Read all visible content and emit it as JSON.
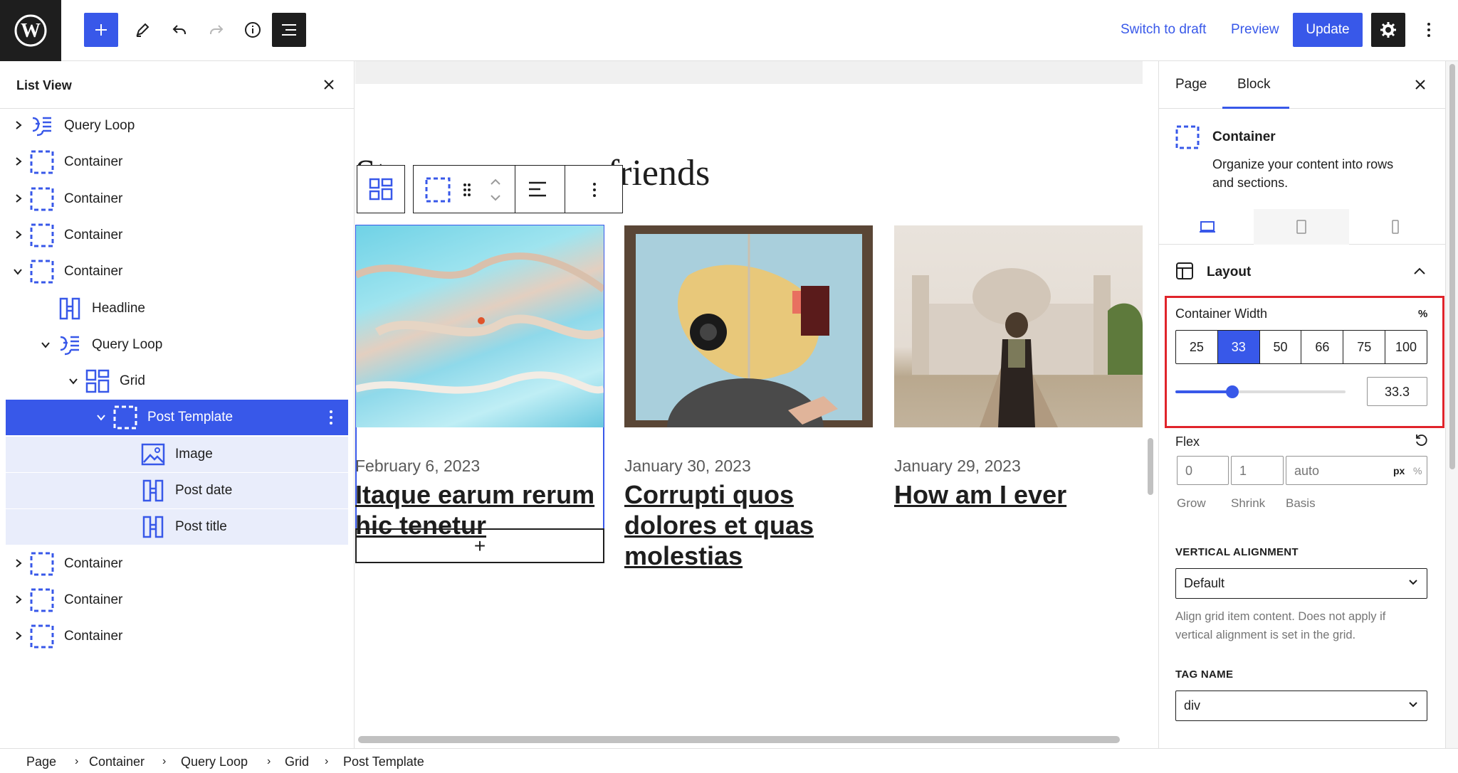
{
  "toolbar": {
    "switch_to_draft": "Switch to draft",
    "preview": "Preview",
    "update": "Update"
  },
  "list_view": {
    "title": "List View",
    "items": [
      {
        "label": "Query Loop",
        "icon": "query-loop-icon"
      },
      {
        "label": "Container",
        "icon": "container-icon"
      },
      {
        "label": "Container",
        "icon": "container-icon"
      },
      {
        "label": "Container",
        "icon": "container-icon"
      },
      {
        "label": "Container",
        "icon": "container-icon"
      },
      {
        "label": "Headline",
        "icon": "headline-icon"
      },
      {
        "label": "Query Loop",
        "icon": "query-loop-icon"
      },
      {
        "label": "Grid",
        "icon": "grid-icon"
      },
      {
        "label": "Post Template",
        "icon": "container-icon"
      },
      {
        "label": "Image",
        "icon": "image-icon"
      },
      {
        "label": "Post date",
        "icon": "headline-icon"
      },
      {
        "label": "Post title",
        "icon": "headline-icon"
      },
      {
        "label": "Container",
        "icon": "container-icon"
      },
      {
        "label": "Container",
        "icon": "container-icon"
      },
      {
        "label": "Container",
        "icon": "container-icon"
      }
    ]
  },
  "canvas": {
    "heading_visible": "friends",
    "posts": [
      {
        "date": "February 6, 2023",
        "title_line1": "Itaque earum rerum",
        "title_line2": "hic tenetur",
        "title_line3": ""
      },
      {
        "date": "January 30, 2023",
        "title_line1": "Corrupti quos",
        "title_line2": "dolores et quas",
        "title_line3": "molestias"
      },
      {
        "date": "January 29, 2023",
        "title_line1": "How am I ever",
        "title_line2": "",
        "title_line3": ""
      }
    ],
    "add_block": "+"
  },
  "settings": {
    "tabs": [
      "Page",
      "Block"
    ],
    "active_tab": "Block",
    "block_name": "Container",
    "block_description_1": "Organize your content into rows",
    "block_description_2": "and sections.",
    "layout_title": "Layout",
    "container_width_label": "Container Width",
    "unit": "%",
    "width_presets": [
      "25",
      "33",
      "50",
      "66",
      "75",
      "100"
    ],
    "selected_preset": "33",
    "width_value": "33.3",
    "width_slider_fraction": 0.333,
    "flex_label": "Flex",
    "flex_grow": "0",
    "flex_shrink": "1",
    "flex_basis_placeholder": "auto",
    "unit_px": "px",
    "unit_pct": "%",
    "grow_label": "Grow",
    "shrink_label": "Shrink",
    "basis_label": "Basis",
    "vertical_alignment_label": "VERTICAL ALIGNMENT",
    "vertical_alignment_value": "Default",
    "vertical_alignment_help_1": "Align grid item content. Does not apply if",
    "vertical_alignment_help_2": "vertical alignment is set in the grid.",
    "tag_name_label": "TAG NAME",
    "tag_name_value": "div"
  },
  "breadcrumb": [
    "Page",
    "Container",
    "Query Loop",
    "Grid",
    "Post Template"
  ],
  "colors": {
    "accent": "#3858e9",
    "dark": "#1e1e1e",
    "highlight_border": "#e0242b"
  }
}
